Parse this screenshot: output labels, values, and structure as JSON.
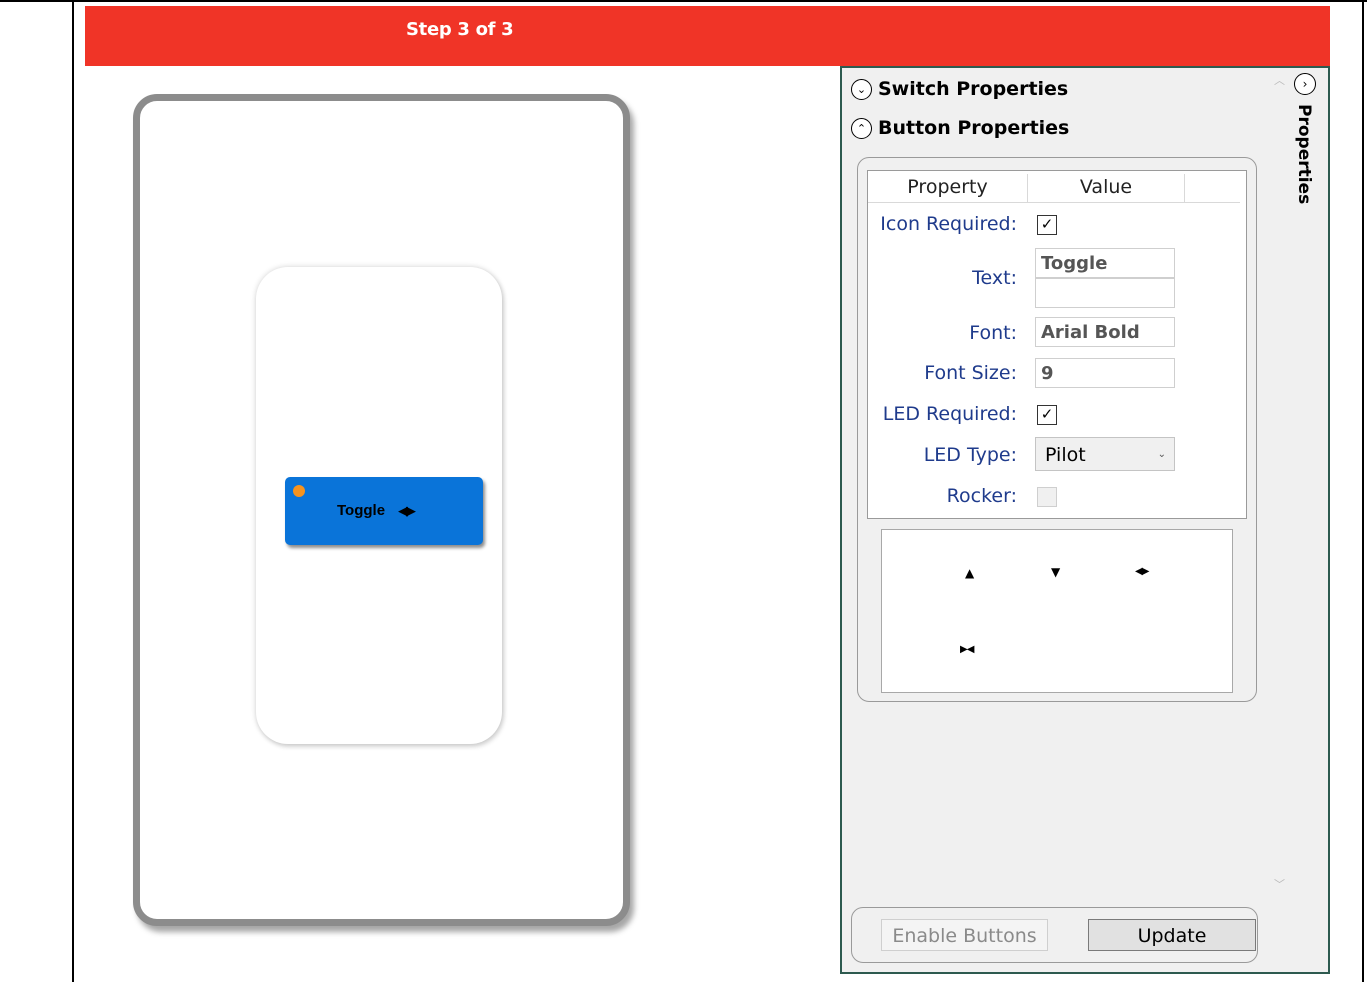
{
  "banner": {
    "title": "Step 3 of 3",
    "color": "#f03427"
  },
  "preview": {
    "button_label": "Toggle",
    "button_icon": "◀▶",
    "button_color": "#0a74d9",
    "led_color": "#f7931e"
  },
  "panel": {
    "side_title": "Properties",
    "side_toggle_icon": "›",
    "sections": {
      "switch": {
        "label": "Switch Properties",
        "icon": "⌄"
      },
      "button": {
        "label": "Button Properties",
        "icon": "⌃"
      }
    },
    "grid": {
      "headers": [
        "Property",
        "Value"
      ],
      "icon_required": {
        "label": "Icon Required:",
        "checked": true,
        "mark": "✓"
      },
      "text": {
        "label": "Text:",
        "line1": "Toggle",
        "line2": ""
      },
      "font": {
        "label": "Font:",
        "value": "Arial Bold"
      },
      "font_size": {
        "label": "Font Size:",
        "value": "9"
      },
      "led_required": {
        "label": "LED Required:",
        "checked": true,
        "mark": "✓"
      },
      "led_type": {
        "label": "LED Type:",
        "value": "Pilot",
        "arrow": "⌄"
      },
      "rocker": {
        "label": "Rocker:",
        "checked": false
      }
    },
    "icons": [
      "▲",
      "▼",
      "◀▶",
      "▶◀"
    ],
    "buttons": {
      "enable": "Enable Buttons",
      "update": "Update"
    }
  }
}
